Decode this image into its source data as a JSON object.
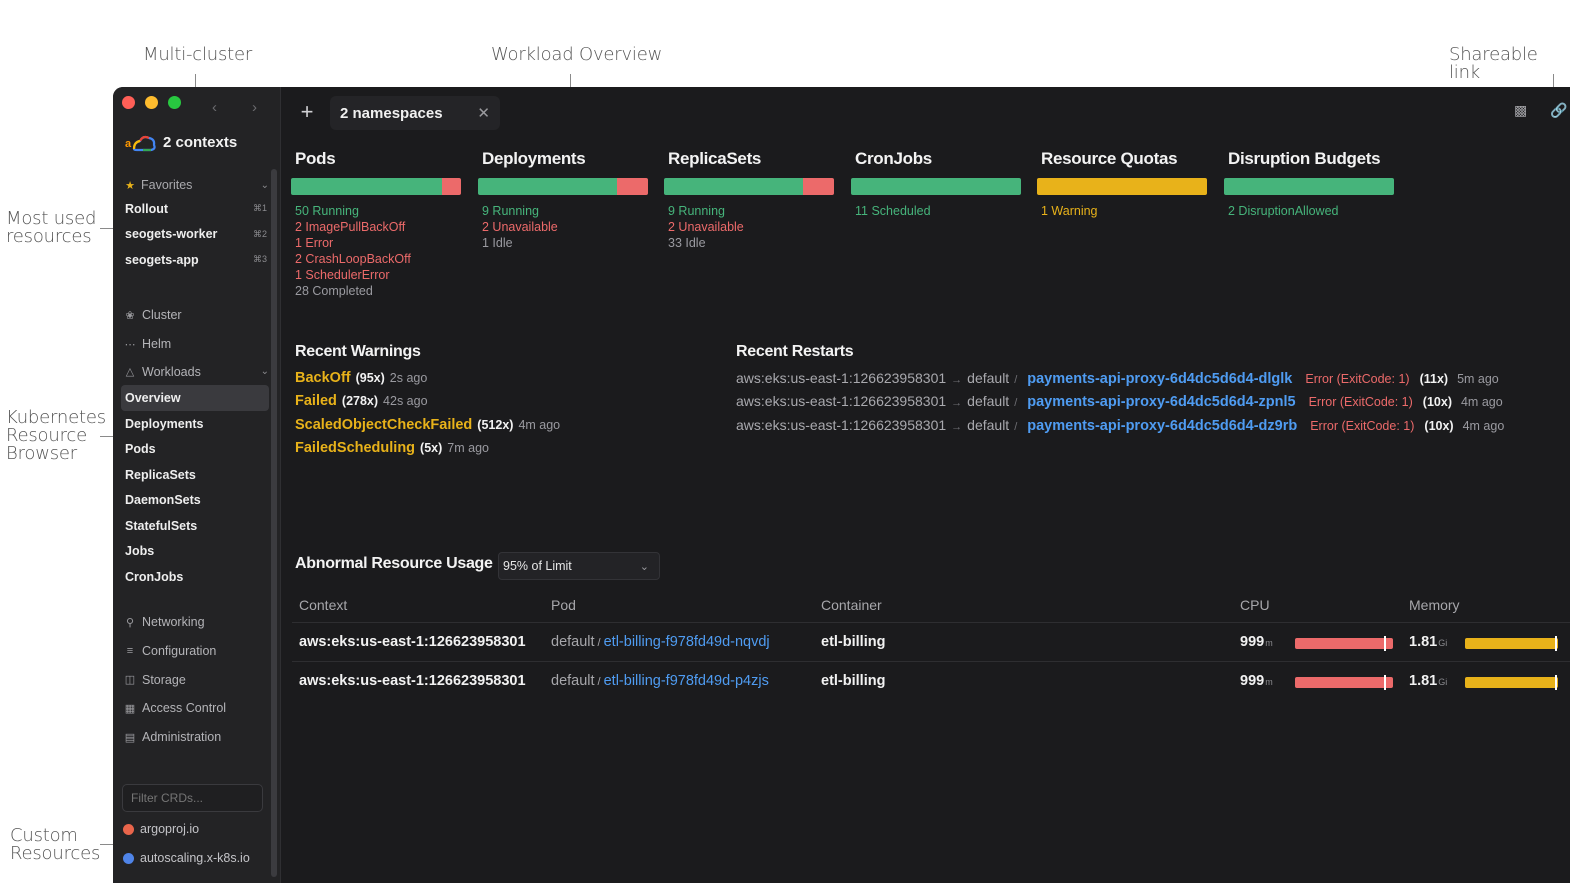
{
  "annotations": {
    "multi_cluster": "Multi-cluster",
    "workload_overview": "Workload Overview",
    "shareable_link": "Shareable link",
    "most_used_1": "Most used",
    "most_used_2": "resources",
    "k8s_1": "Kubernetes",
    "k8s_2": "Resource",
    "k8s_3": "Browser",
    "custom_1": "Custom",
    "custom_2": "Resources"
  },
  "sidebar": {
    "contexts_label": "2 contexts",
    "favorites": {
      "header": "Favorites",
      "items": [
        {
          "label": "Rollout",
          "shortcut": "⌘1"
        },
        {
          "label": "seogets-worker",
          "shortcut": "⌘2"
        },
        {
          "label": "seogets-app",
          "shortcut": "⌘3"
        }
      ]
    },
    "cluster": "Cluster",
    "helm": "Helm",
    "workloads": {
      "header": "Workloads",
      "items": [
        "Overview",
        "Deployments",
        "Pods",
        "ReplicaSets",
        "DaemonSets",
        "StatefulSets",
        "Jobs",
        "CronJobs"
      ],
      "active": "Overview"
    },
    "groups": [
      "Networking",
      "Configuration",
      "Storage",
      "Access Control",
      "Administration"
    ],
    "crd_filter_placeholder": "Filter CRDs...",
    "crds": [
      "argoproj.io",
      "autoscaling.x-k8s.io"
    ]
  },
  "tabbar": {
    "add_label": "+",
    "tab_label": "2 namespaces",
    "close_label": "✕"
  },
  "summary_cards": [
    {
      "title": "Pods",
      "bar": {
        "green": 0.89,
        "red": 0.11,
        "yellow": 0
      },
      "stats": [
        {
          "text": "50 Running",
          "color": "green"
        },
        {
          "text": "2 ImagePullBackOff",
          "color": "red"
        },
        {
          "text": "1 Error",
          "color": "red"
        },
        {
          "text": "2 CrashLoopBackOff",
          "color": "red"
        },
        {
          "text": "1 SchedulerError",
          "color": "red"
        },
        {
          "text": "28 Completed",
          "color": "gray"
        }
      ]
    },
    {
      "title": "Deployments",
      "bar": {
        "green": 0.82,
        "red": 0.18,
        "yellow": 0
      },
      "stats": [
        {
          "text": "9 Running",
          "color": "green"
        },
        {
          "text": "2 Unavailable",
          "color": "red"
        },
        {
          "text": "1 Idle",
          "color": "gray"
        }
      ]
    },
    {
      "title": "ReplicaSets",
      "bar": {
        "green": 0.82,
        "red": 0.18,
        "yellow": 0
      },
      "stats": [
        {
          "text": "9 Running",
          "color": "green"
        },
        {
          "text": "2 Unavailable",
          "color": "red"
        },
        {
          "text": "33 Idle",
          "color": "gray"
        }
      ]
    },
    {
      "title": "CronJobs",
      "bar": {
        "green": 1,
        "red": 0,
        "yellow": 0
      },
      "stats": [
        {
          "text": "11 Scheduled",
          "color": "green"
        }
      ]
    },
    {
      "title": "Resource Quotas",
      "bar": {
        "green": 0,
        "red": 0,
        "yellow": 1
      },
      "stats": [
        {
          "text": "1 Warning",
          "color": "yellow"
        }
      ]
    },
    {
      "title": "Disruption Budgets",
      "bar": {
        "green": 1,
        "red": 0,
        "yellow": 0
      },
      "stats": [
        {
          "text": "2 DisruptionAllowed",
          "color": "green"
        }
      ]
    }
  ],
  "recent_warnings": {
    "title": "Recent Warnings",
    "items": [
      {
        "name": "BackOff",
        "count": "(95x)",
        "ago": "2s ago"
      },
      {
        "name": "Failed",
        "count": "(278x)",
        "ago": "42s ago"
      },
      {
        "name": "ScaledObjectCheckFailed",
        "count": "(512x)",
        "ago": "4m ago"
      },
      {
        "name": "FailedScheduling",
        "count": "(5x)",
        "ago": "7m ago"
      }
    ]
  },
  "recent_restarts": {
    "title": "Recent Restarts",
    "items": [
      {
        "context": "aws:eks:us-east-1:126623958301",
        "namespace": "default",
        "pod": "payments-api-proxy-6d4dc5d6d4-dlglk",
        "error": "Error (ExitCode: 1)",
        "count": "(11x)",
        "ago": "5m ago"
      },
      {
        "context": "aws:eks:us-east-1:126623958301",
        "namespace": "default",
        "pod": "payments-api-proxy-6d4dc5d6d4-zpnl5",
        "error": "Error (ExitCode: 1)",
        "count": "(10x)",
        "ago": "4m ago"
      },
      {
        "context": "aws:eks:us-east-1:126623958301",
        "namespace": "default",
        "pod": "payments-api-proxy-6d4dc5d6d4-dz9rb",
        "error": "Error (ExitCode: 1)",
        "count": "(10x)",
        "ago": "4m ago"
      }
    ]
  },
  "abnormal_usage": {
    "title": "Abnormal Resource Usage",
    "filter_value": "95% of Limit",
    "columns": [
      "Context",
      "Pod",
      "Container",
      "CPU",
      "Memory"
    ],
    "rows": [
      {
        "context": "aws:eks:us-east-1:126623958301",
        "namespace": "default",
        "pod": "etl-billing-f978fd49d-nqvdj",
        "container": "etl-billing",
        "cpu": "999",
        "cpu_unit": "m",
        "cpu_usage": 0.91,
        "memory": "1.81",
        "memory_unit": "Gi",
        "memory_usage": 0.97
      },
      {
        "context": "aws:eks:us-east-1:126623958301",
        "namespace": "default",
        "pod": "etl-billing-f978fd49d-p4zjs",
        "container": "etl-billing",
        "cpu": "999",
        "cpu_unit": "m",
        "cpu_usage": 0.91,
        "memory": "1.81",
        "memory_unit": "Gi",
        "memory_usage": 0.97
      }
    ]
  },
  "colors": {
    "green": "#46b47b",
    "red": "#ec6a6a",
    "yellow": "#e8b21a",
    "link": "#4f9cf2",
    "window_bg": "#1b1b1d",
    "sidebar_bg": "#232325"
  }
}
